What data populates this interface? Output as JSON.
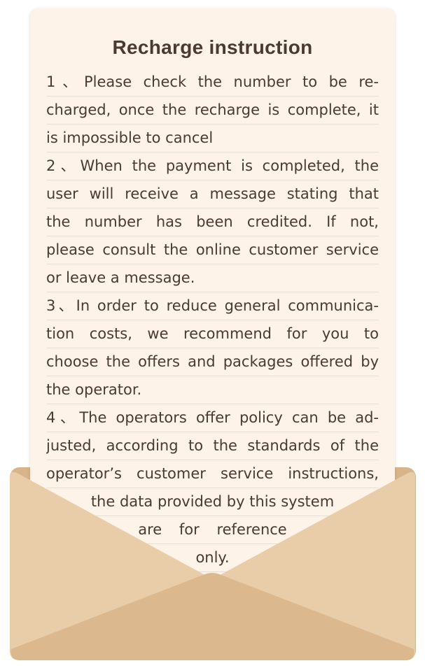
{
  "title": "Recharge instruction",
  "lines": [
    "1、Please check the number to be re-",
    "charged, once the recharge is complete, it",
    "is impossible to cancel",
    "2、When the payment is completed, the",
    "user will receive a message stating that",
    "the number has been credited. If not,",
    "please consult the online customer service",
    "or leave a message.",
    "3、In order to reduce general communica-",
    "tion costs, we recommend for you  to",
    "choose the offers and packages offered by",
    "the operator.",
    "4、The operators offer policy can be ad-",
    "justed, according to the standards of the",
    "operator’s customer service instructions,",
    "the data provided by this system",
    "are for reference",
    "only."
  ],
  "colors": {
    "paper": "#fdf3e8",
    "text": "#4a3a30",
    "envelope_back": "#d7b48a",
    "envelope_side": "#e8cda8",
    "envelope_bottom": "#dcb88f"
  }
}
